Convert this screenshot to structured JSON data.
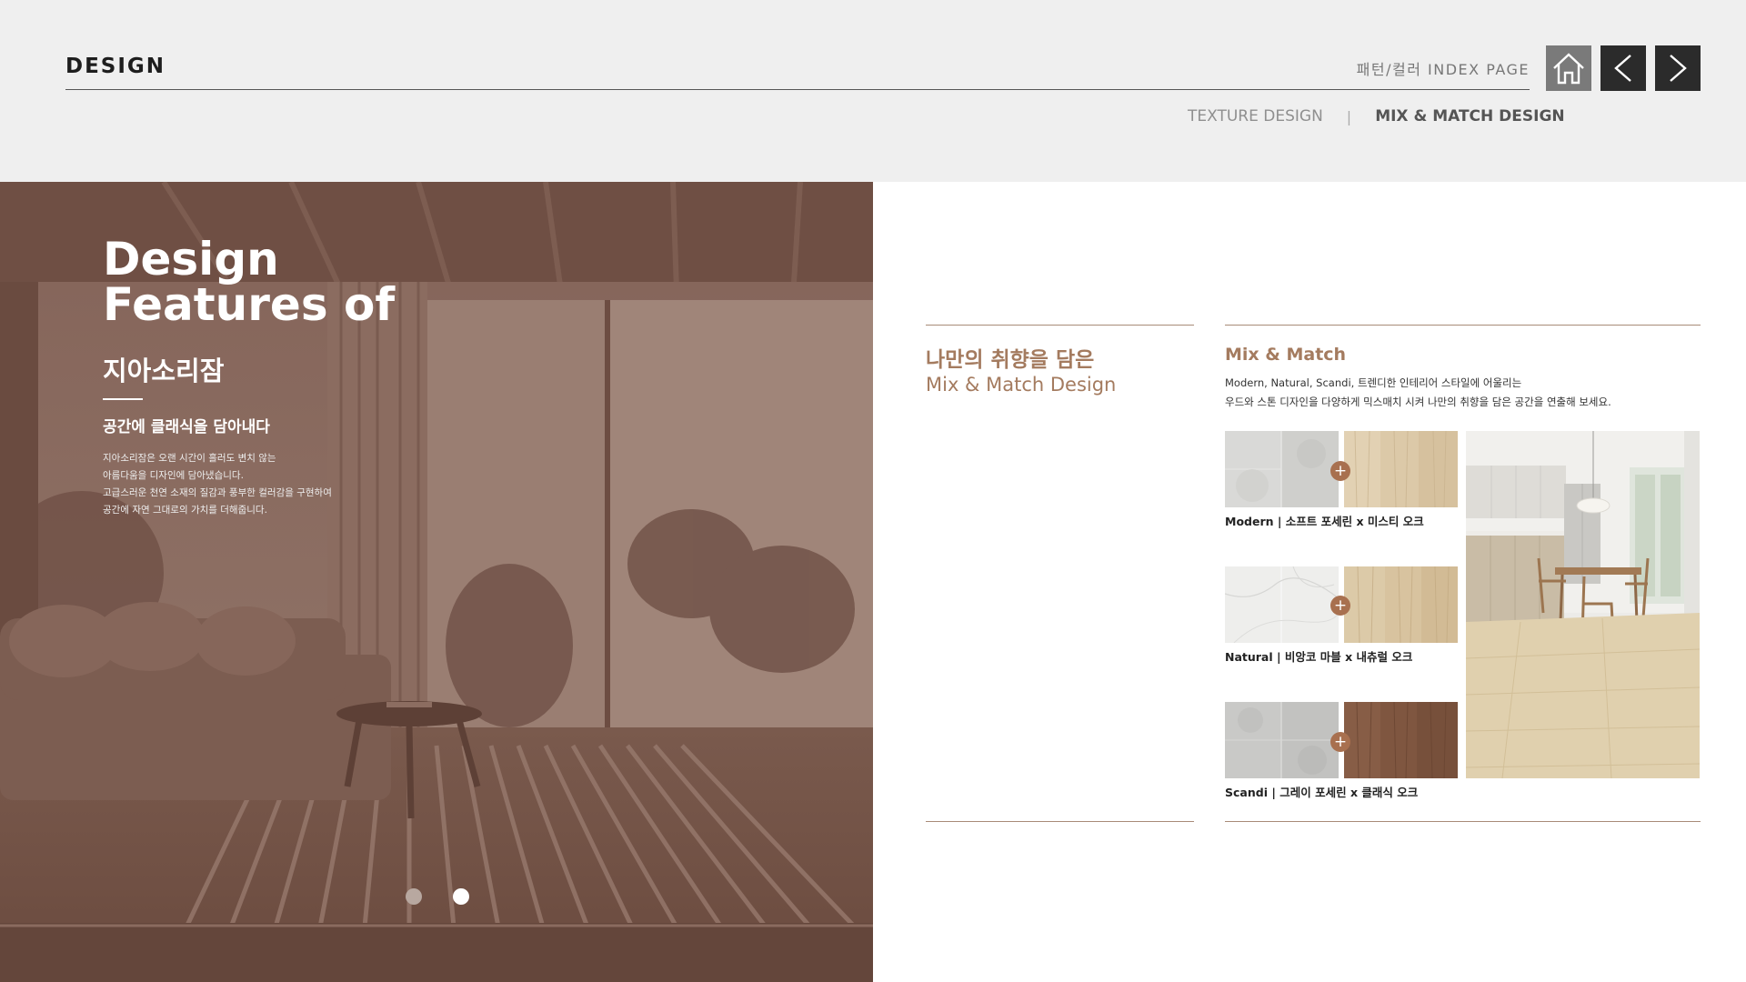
{
  "header": {
    "title": "DESIGN",
    "index_link": "패턴/컬러 INDEX PAGE",
    "nav": {
      "home_icon": "home-icon",
      "prev_icon": "chevron-left-icon",
      "next_icon": "chevron-right-icon"
    },
    "tabs": [
      {
        "label": "TEXTURE DESIGN",
        "active": false
      },
      {
        "label": "MIX & MATCH DESIGN",
        "active": true
      }
    ],
    "separator": "|"
  },
  "hero": {
    "title_line1": "Design",
    "title_line2": "Features of",
    "brand": "지아소리잠",
    "subtitle": "공간에 클래식을 담아내다",
    "body": [
      "지아소리잠은 오랜 시간이 흘러도 변치 않는",
      "아름다움을 디자인에 담아냈습니다.",
      "고급스러운 천연 소재의 질감과 풍부한 컬러감을 구현하여",
      "공간에 자연 그대로의 가치를 더해줍니다."
    ],
    "slides": {
      "count": 2,
      "active": 2
    }
  },
  "intro": {
    "heading_kr": "나만의 취향을 담은",
    "heading_en": "Mix & Match Design"
  },
  "mix_match": {
    "title": "Mix & Match",
    "description": [
      "Modern, Natural, Scandi, 트렌디한 인테리어 스타일에 어울리는",
      "우드와 스톤 디자인을 다양하게 믹스매치 시켜 나만의 취향을 담은 공간을 연출해 보세요."
    ],
    "combos": [
      {
        "label": "Modern | 소프트 포세린 x 미스티 오크",
        "plus": "+"
      },
      {
        "label": "Natural | 비앙코 마블 x 내츄럴 오크",
        "plus": "+"
      },
      {
        "label": "Scandi | 그레이 포세린 x 클래식 오크",
        "plus": "+"
      }
    ]
  },
  "colors": {
    "header_bg": "#efefef",
    "accent": "#a47b5f",
    "hero_tint": "#6e4a3d",
    "plus_badge": "#a8704f",
    "nav_home": "#7a7a7a",
    "nav_arrows": "#2b2b2b"
  }
}
